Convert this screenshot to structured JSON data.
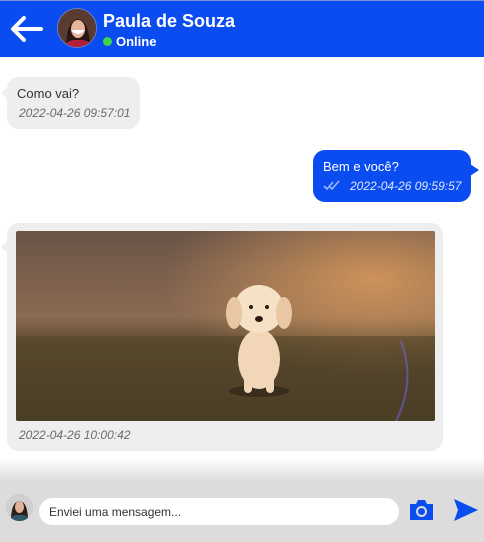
{
  "header": {
    "contact_name": "Paula de Souza",
    "status": "Online",
    "status_color": "#3ad54a",
    "background_color": "#0a4cf0"
  },
  "messages": [
    {
      "direction": "incoming",
      "text": "Como vai?",
      "time": "2022-04-26 09:57:01"
    },
    {
      "direction": "outgoing",
      "text": "Bem e você?",
      "time": "2022-04-26 09:59:57",
      "icon": "double-check-icon"
    },
    {
      "direction": "incoming",
      "type": "image",
      "image": "puppy-running-photo",
      "time": "2022-04-26 10:00:42"
    }
  ],
  "composer": {
    "placeholder": "Enviei uma mensagem...",
    "camera_icon": "camera-icon",
    "send_icon": "send-icon"
  }
}
